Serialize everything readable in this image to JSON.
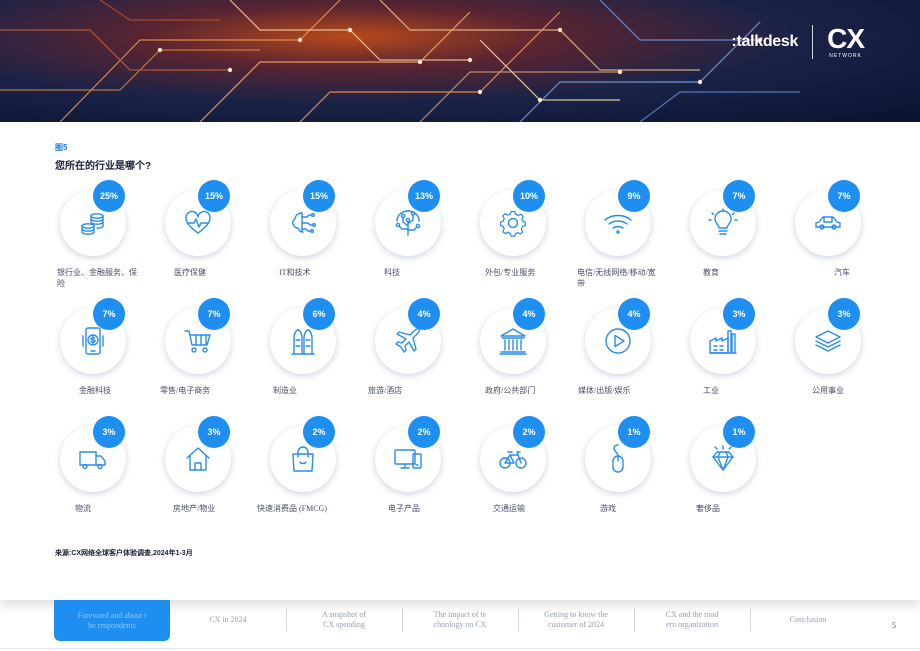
{
  "brand": {
    "talkdesk": ":talkdesk",
    "cx": "CX",
    "network": "NETWORK"
  },
  "figure": {
    "label": "图5",
    "title": "您所在的行业是哪个?"
  },
  "accent_color": "#1e8ff0",
  "items": [
    {
      "pct": "25%",
      "label": "银行业、金融服务、保险",
      "icon": "coins-icon"
    },
    {
      "pct": "15%",
      "label": "医疗保健",
      "icon": "heart-pulse-icon"
    },
    {
      "pct": "15%",
      "label": "IT和技术",
      "icon": "chip-brain-icon"
    },
    {
      "pct": "13%",
      "label": "科技",
      "icon": "circuit-tree-icon"
    },
    {
      "pct": "10%",
      "label": "外包/专业服务",
      "icon": "gear-icon"
    },
    {
      "pct": "9%",
      "label": "电信/无线网络/移动/宽带",
      "icon": "wifi-icon"
    },
    {
      "pct": "7%",
      "label": "教育",
      "icon": "lightbulb-icon"
    },
    {
      "pct": "7%",
      "label": "汽车",
      "icon": "car-icon"
    },
    {
      "pct": "7%",
      "label": "金融科技",
      "icon": "mobile-dollar-icon"
    },
    {
      "pct": "7%",
      "label": "零售/电子商务",
      "icon": "shopping-cart-icon"
    },
    {
      "pct": "6%",
      "label": "制造业",
      "icon": "manufacturing-icon"
    },
    {
      "pct": "4%",
      "label": "旅游/酒店",
      "icon": "airplane-icon"
    },
    {
      "pct": "4%",
      "label": "政府/公共部门",
      "icon": "government-building-icon"
    },
    {
      "pct": "4%",
      "label": "媒体/出版/娱乐",
      "icon": "play-icon"
    },
    {
      "pct": "3%",
      "label": "工业",
      "icon": "factory-icon"
    },
    {
      "pct": "3%",
      "label": "公用事业",
      "icon": "layers-icon"
    },
    {
      "pct": "3%",
      "label": "物流",
      "icon": "truck-icon"
    },
    {
      "pct": "3%",
      "label": "房地产/物业",
      "icon": "house-icon"
    },
    {
      "pct": "2%",
      "label": "快速消费品 (FMCG)",
      "icon": "shopping-bag-icon"
    },
    {
      "pct": "2%",
      "label": "电子产品",
      "icon": "devices-icon"
    },
    {
      "pct": "2%",
      "label": "交通运输",
      "icon": "bicycle-icon"
    },
    {
      "pct": "1%",
      "label": "游戏",
      "icon": "mouse-icon"
    },
    {
      "pct": "1%",
      "label": "奢侈品",
      "icon": "diamond-icon"
    }
  ],
  "source": "来源:CX网络全球客户体验调查,2024年1-3月",
  "nav": [
    {
      "label": "Foreword and about t\nhe respondents",
      "active": true
    },
    {
      "label": "CX in 2024"
    },
    {
      "label": "A snapshot of\nCX spending"
    },
    {
      "label": "The impact of te\nchnology on CX"
    },
    {
      "label": "Getting to know the\ncustomer of 2024"
    },
    {
      "label": "CX and the mod\nern organization"
    },
    {
      "label": "Conclusion"
    }
  ],
  "page_number": "5"
}
